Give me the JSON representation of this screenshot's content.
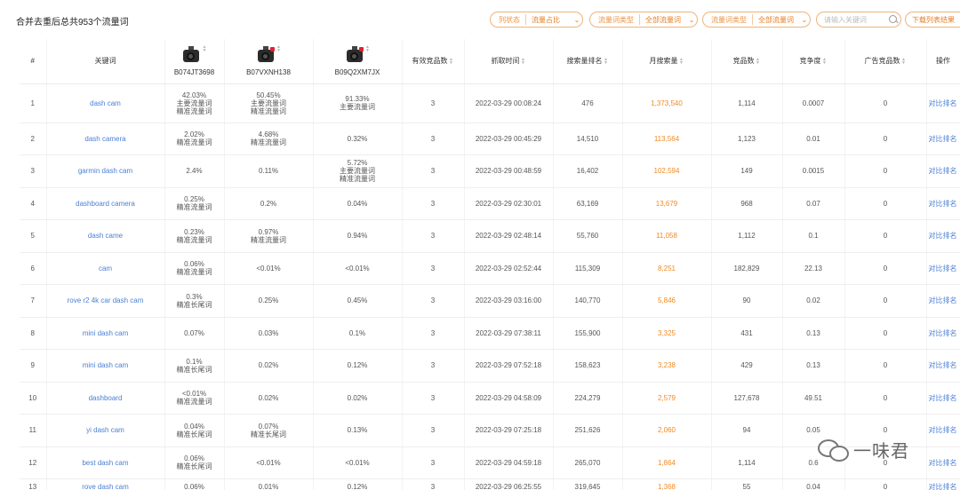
{
  "summary": "合并去重后总共953个流量词",
  "filters": [
    {
      "label": "列状态",
      "value": "流量占比"
    },
    {
      "label": "流量词类型",
      "value": "全部流量词"
    },
    {
      "label": "流量词类型",
      "value": "全部流量词"
    }
  ],
  "search": {
    "placeholder": "请输入关键词"
  },
  "download_label": "下载列表结果",
  "columns": {
    "index": "#",
    "keyword": "关键词",
    "products": [
      {
        "asin": "B074JT3698",
        "image": "dash-cam-product-image"
      },
      {
        "asin": "B07VXNH138",
        "image": "dash-cam-product-image"
      },
      {
        "asin": "B09Q2XM7JX",
        "image": "dash-cam-product-image"
      }
    ],
    "valid_count": "有效竞品数",
    "fetch_time": "抓取时间",
    "search_rank": "搜索量排名",
    "monthly_search": "月搜索量",
    "product_count": "竞品数",
    "competition": "竞争度",
    "ad_count": "广告竞品数",
    "action": "操作"
  },
  "rows": [
    {
      "idx": "1",
      "kw": "dash cam",
      "p1": [
        "42.03%",
        "主要流量词",
        "精准流量词"
      ],
      "p2": [
        "50.45%",
        "主要流量词",
        "精准流量词"
      ],
      "p3": [
        "91.33%",
        "主要流量词"
      ],
      "valid": "3",
      "time": "2022-03-29 00:08:24",
      "rank": "476",
      "ms": "1,373,540",
      "prod": "1,114",
      "comp": "0.0007",
      "ad": "0",
      "op": "对比排名"
    },
    {
      "idx": "2",
      "kw": "dash camera",
      "p1": [
        "2.02%",
        "精准流量词"
      ],
      "p2": [
        "4.68%",
        "精准流量词"
      ],
      "p3": [
        "0.32%"
      ],
      "valid": "3",
      "time": "2022-03-29 00:45:29",
      "rank": "14,510",
      "ms": "113,564",
      "prod": "1,123",
      "comp": "0.01",
      "ad": "0",
      "op": "对比排名"
    },
    {
      "idx": "3",
      "kw": "garmin dash cam",
      "p1": [
        "2.4%"
      ],
      "p2": [
        "0.11%"
      ],
      "p3": [
        "5.72%",
        "主要流量词",
        "精准流量词"
      ],
      "valid": "3",
      "time": "2022-03-29 00:48:59",
      "rank": "16,402",
      "ms": "102,594",
      "prod": "149",
      "comp": "0.0015",
      "ad": "0",
      "op": "对比排名"
    },
    {
      "idx": "4",
      "kw": "dashboard camera",
      "p1": [
        "0.25%",
        "精准流量词"
      ],
      "p2": [
        "0.2%"
      ],
      "p3": [
        "0.04%"
      ],
      "valid": "3",
      "time": "2022-03-29 02:30:01",
      "rank": "63,169",
      "ms": "13,679",
      "prod": "968",
      "comp": "0.07",
      "ad": "0",
      "op": "对比排名"
    },
    {
      "idx": "5",
      "kw": "dash came",
      "p1": [
        "0.23%",
        "精准流量词"
      ],
      "p2": [
        "0.97%",
        "精准流量词"
      ],
      "p3": [
        "0.94%"
      ],
      "valid": "3",
      "time": "2022-03-29 02:48:14",
      "rank": "55,760",
      "ms": "11,058",
      "prod": "1,112",
      "comp": "0.1",
      "ad": "0",
      "op": "对比排名"
    },
    {
      "idx": "6",
      "kw": "cam",
      "p1": [
        "0.06%",
        "精准流量词"
      ],
      "p2": [
        "<0.01%"
      ],
      "p3": [
        "<0.01%"
      ],
      "valid": "3",
      "time": "2022-03-29 02:52:44",
      "rank": "115,309",
      "ms": "8,251",
      "prod": "182,829",
      "comp": "22.13",
      "ad": "0",
      "op": "对比排名"
    },
    {
      "idx": "7",
      "kw": "rove r2 4k car dash cam",
      "p1": [
        "0.3%",
        "精准长尾词"
      ],
      "p2": [
        "0.25%"
      ],
      "p3": [
        "0.45%"
      ],
      "valid": "3",
      "time": "2022-03-29 03:16:00",
      "rank": "140,770",
      "ms": "5,846",
      "prod": "90",
      "comp": "0.02",
      "ad": "0",
      "op": "对比排名"
    },
    {
      "idx": "8",
      "kw": "mini dash cam",
      "p1": [
        "0.07%"
      ],
      "p2": [
        "0.03%"
      ],
      "p3": [
        "0.1%"
      ],
      "valid": "3",
      "time": "2022-03-29 07:38:11",
      "rank": "155,900",
      "ms": "3,325",
      "prod": "431",
      "comp": "0.13",
      "ad": "0",
      "op": "对比排名"
    },
    {
      "idx": "9",
      "kw": "mini dash cam",
      "p1": [
        "0.1%",
        "精准长尾词"
      ],
      "p2": [
        "0.02%"
      ],
      "p3": [
        "0.12%"
      ],
      "valid": "3",
      "time": "2022-03-29 07:52:18",
      "rank": "158,623",
      "ms": "3,238",
      "prod": "429",
      "comp": "0.13",
      "ad": "0",
      "op": "对比排名"
    },
    {
      "idx": "10",
      "kw": "dashboard",
      "p1": [
        "<0.01%",
        "精准流量词"
      ],
      "p2": [
        "0.02%"
      ],
      "p3": [
        "0.02%"
      ],
      "valid": "3",
      "time": "2022-03-29 04:58:09",
      "rank": "224,279",
      "ms": "2,579",
      "prod": "127,678",
      "comp": "49.51",
      "ad": "0",
      "op": "对比排名"
    },
    {
      "idx": "11",
      "kw": "yi dash cam",
      "p1": [
        "0.04%",
        "精准长尾词"
      ],
      "p2": [
        "0.07%",
        "精准长尾词"
      ],
      "p3": [
        "0.13%"
      ],
      "valid": "3",
      "time": "2022-03-29 07:25:18",
      "rank": "251,626",
      "ms": "2,060",
      "prod": "94",
      "comp": "0.05",
      "ad": "0",
      "op": "对比排名"
    },
    {
      "idx": "12",
      "kw": "best dash cam",
      "p1": [
        "0.06%",
        "精准长尾词"
      ],
      "p2": [
        "<0.01%"
      ],
      "p3": [
        "<0.01%"
      ],
      "valid": "3",
      "time": "2022-03-29 04:59:18",
      "rank": "265,070",
      "ms": "1,864",
      "prod": "1,114",
      "comp": "0.6",
      "ad": "0",
      "op": "对比排名"
    },
    {
      "idx": "13",
      "kw": "rove dash cam",
      "p1": [
        "0.06%"
      ],
      "p2": [
        "0.01%"
      ],
      "p3": [
        "0.12%"
      ],
      "valid": "3",
      "time": "2022-03-29 06:25:55",
      "rank": "319,645",
      "ms": "1,368",
      "prod": "55",
      "comp": "0.04",
      "ad": "0",
      "op": "对比排名"
    }
  ],
  "watermark": {
    "text": "一味君",
    "icon": "wechat-icon"
  },
  "colors": {
    "accent": "#e67e22",
    "link": "#4a7fd4",
    "monthly_search": "#f08a24"
  }
}
